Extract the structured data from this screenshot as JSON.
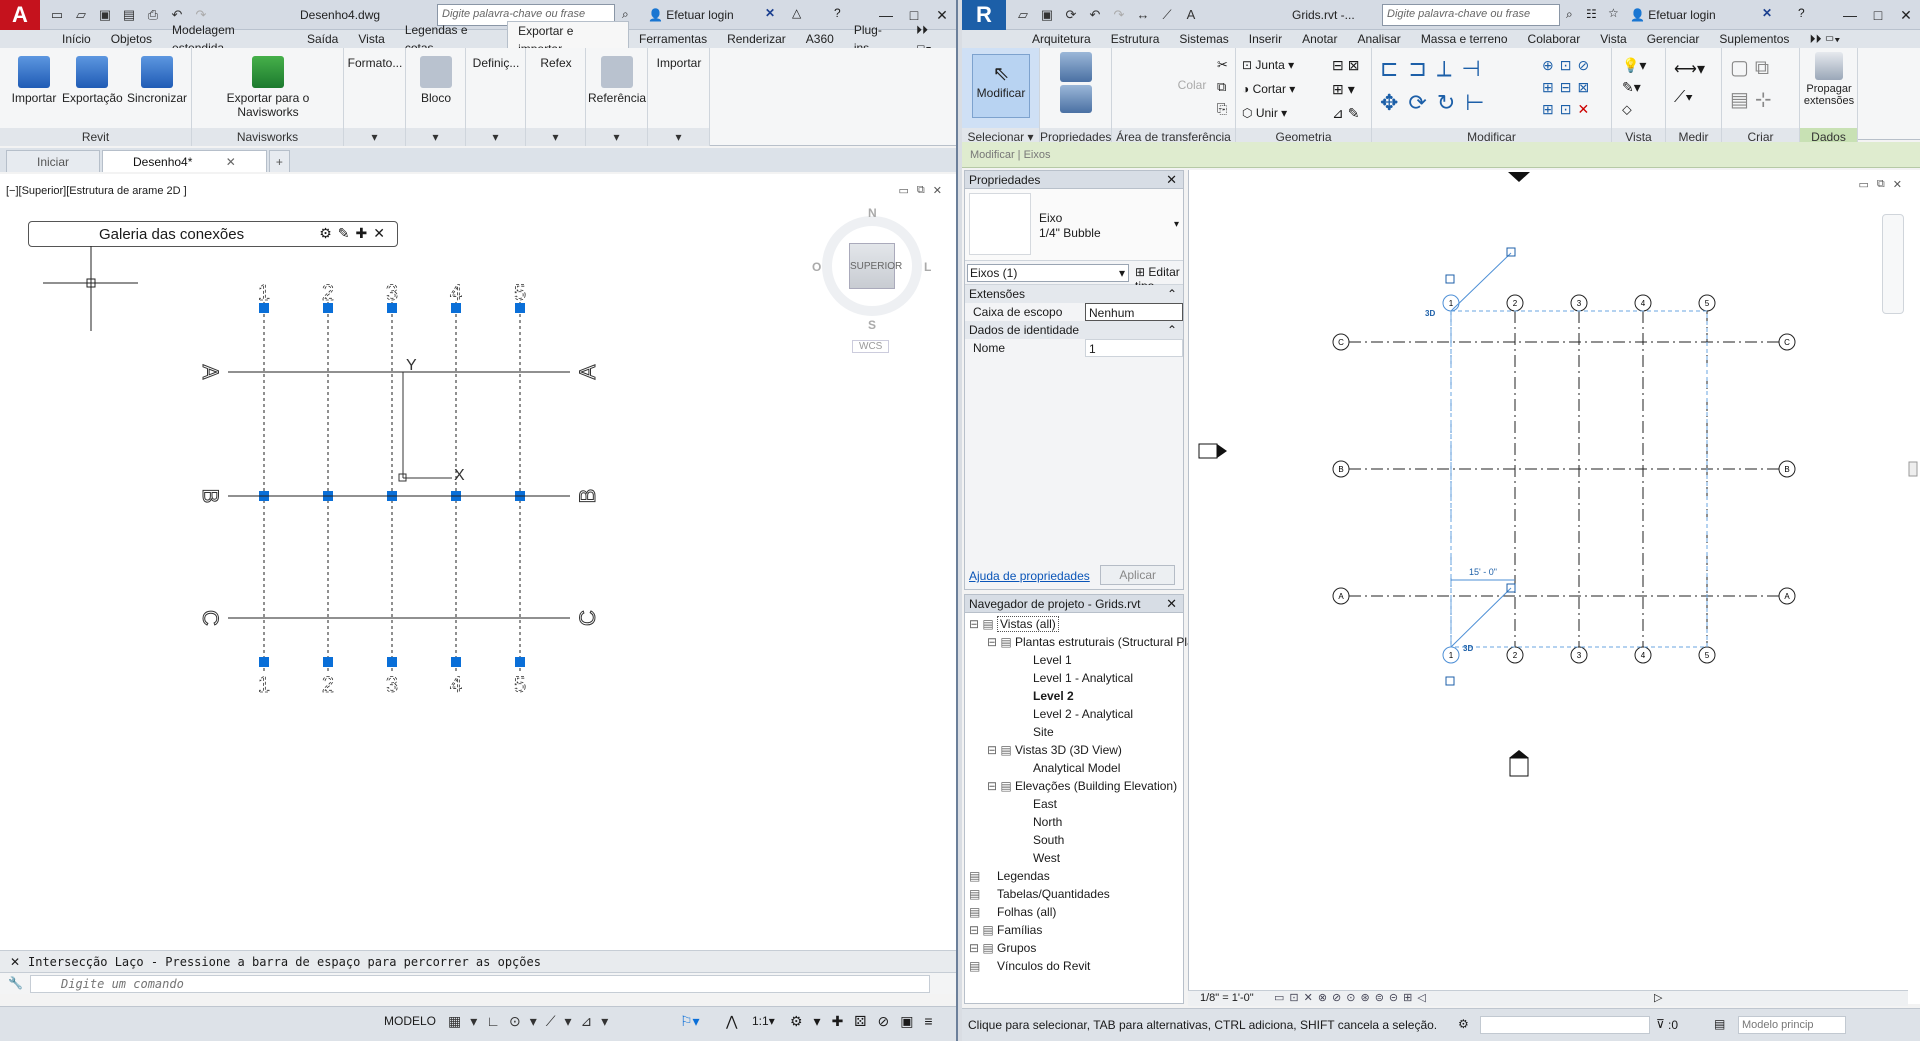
{
  "autocad": {
    "logo": "A",
    "title": "Desenho4.dwg",
    "search_placeholder": "Digite palavra-chave ou frase",
    "login": "Efetuar login",
    "tabs": [
      "Início",
      "Objetos",
      "Modelagem estendida",
      "Saída",
      "Vista",
      "Legendas e cotas",
      "Exportar e importar",
      "Ferramentas",
      "Renderizar",
      "A360",
      "Plug-ins"
    ],
    "active_tab": "Exportar e importar",
    "ribbon": {
      "revit_panel": "Revit",
      "navisworks_panel": "Navisworks",
      "btn_import": "Importar",
      "btn_export": "Exportação",
      "btn_sync": "Sincronizar",
      "btn_export_nw": "Exportar para o Navisworks",
      "btn_format": "Formato...",
      "btn_block": "Bloco",
      "btn_defin": "Definiç...",
      "btn_refex": "Refex",
      "btn_ref": "Referência",
      "btn_importar": "Importar"
    },
    "doc_tabs": [
      "Iniciar",
      "Desenho4*"
    ],
    "viewport_label": "[−][Superior][Estrutura de arame 2D ]",
    "gallery_title": "Galeria das conexões",
    "viewcube": {
      "n": "N",
      "s": "S",
      "e": "L",
      "w": "O",
      "face": "SUPERIOR",
      "wcs": "WCS"
    },
    "ucs": {
      "x": "X",
      "y": "Y"
    },
    "grid_numbers": [
      "1",
      "2",
      "3",
      "4",
      "5"
    ],
    "grid_letters": [
      "A",
      "B",
      "C"
    ],
    "command_history": "Intersecção Laço - Pressione a barra de espaço para percorrer as opções",
    "command_placeholder": "Digite um comando",
    "status": {
      "model": "MODELO",
      "scale": "1:1"
    }
  },
  "revit": {
    "logo": "R",
    "title": "Grids.rvt -...",
    "search_placeholder": "Digite palavra-chave ou frase",
    "login": "Efetuar login",
    "tabs": [
      "Arquitetura",
      "Estrutura",
      "Sistemas",
      "Inserir",
      "Anotar",
      "Analisar",
      "Massa e terreno",
      "Colaborar",
      "Vista",
      "Gerenciar",
      "Suplementos"
    ],
    "ribbon": {
      "modify": "Modificar",
      "select": "Selecionar",
      "properties": "Propriedades",
      "clipboard": "Área de transferência",
      "paste": "Colar",
      "geometry": "Geometria",
      "join": "Junta",
      "cut": "Cortar",
      "unir": "Unir",
      "modify_panel": "Modificar",
      "view": "Vista",
      "measure": "Medir",
      "create": "Criar",
      "propagate": "Propagar extensões",
      "data": "Dados"
    },
    "context_bar": "Modificar | Eixos",
    "properties": {
      "title": "Propriedades",
      "type_line1": "Eixo",
      "type_line2": "1/4\" Bubble",
      "filter": "Eixos (1)",
      "edit_type": "Editar tipo",
      "sec_extents": "Extensões",
      "scope_box_label": "Caixa de escopo",
      "scope_box_value": "Nenhum",
      "sec_identity": "Dados de identidade",
      "name_label": "Nome",
      "name_value": "1",
      "help_link": "Ajuda de propriedades",
      "apply": "Aplicar"
    },
    "browser": {
      "title": "Navegador de projeto - Grids.rvt",
      "items": [
        {
          "label": "Vistas (all)",
          "level": 0,
          "bold": false
        },
        {
          "label": "Plantas estruturais (Structural Plan)",
          "level": 1,
          "bold": false
        },
        {
          "label": "Level 1",
          "level": 2,
          "bold": false
        },
        {
          "label": "Level 1 - Analytical",
          "level": 2,
          "bold": false
        },
        {
          "label": "Level 2",
          "level": 2,
          "bold": true
        },
        {
          "label": "Level 2 - Analytical",
          "level": 2,
          "bold": false
        },
        {
          "label": "Site",
          "level": 2,
          "bold": false
        },
        {
          "label": "Vistas 3D (3D View)",
          "level": 1,
          "bold": false
        },
        {
          "label": "Analytical Model",
          "level": 2,
          "bold": false
        },
        {
          "label": "Elevações (Building Elevation)",
          "level": 1,
          "bold": false
        },
        {
          "label": "East",
          "level": 2,
          "bold": false
        },
        {
          "label": "North",
          "level": 2,
          "bold": false
        },
        {
          "label": "South",
          "level": 2,
          "bold": false
        },
        {
          "label": "West",
          "level": 2,
          "bold": false
        },
        {
          "label": "Legendas",
          "level": 0,
          "bold": false
        },
        {
          "label": "Tabelas/Quantidades",
          "level": 0,
          "bold": false
        },
        {
          "label": "Folhas (all)",
          "level": 0,
          "bold": false
        },
        {
          "label": "Famílias",
          "level": 0,
          "bold": false
        },
        {
          "label": "Grupos",
          "level": 0,
          "bold": false
        },
        {
          "label": "Vínculos do Revit",
          "level": 0,
          "bold": false
        }
      ]
    },
    "grid_numbers": [
      "1",
      "2",
      "3",
      "4",
      "5"
    ],
    "grid_letters": [
      "C",
      "B",
      "A"
    ],
    "dimension": "15' - 0\"",
    "tag_3d": "3D",
    "scale": "1/8\" = 1'-0\"",
    "status_text": "Clique para selecionar, TAB para alternativas, CTRL adiciona, SHIFT cancela a seleção.",
    "status_zero": ":0",
    "status_model": "Modelo princip"
  },
  "colors": {
    "accent": "#0a6fd8",
    "acad_red": "#c5121d",
    "revit_blue": "#1c5fa8",
    "context_green": "#dfeccf"
  }
}
